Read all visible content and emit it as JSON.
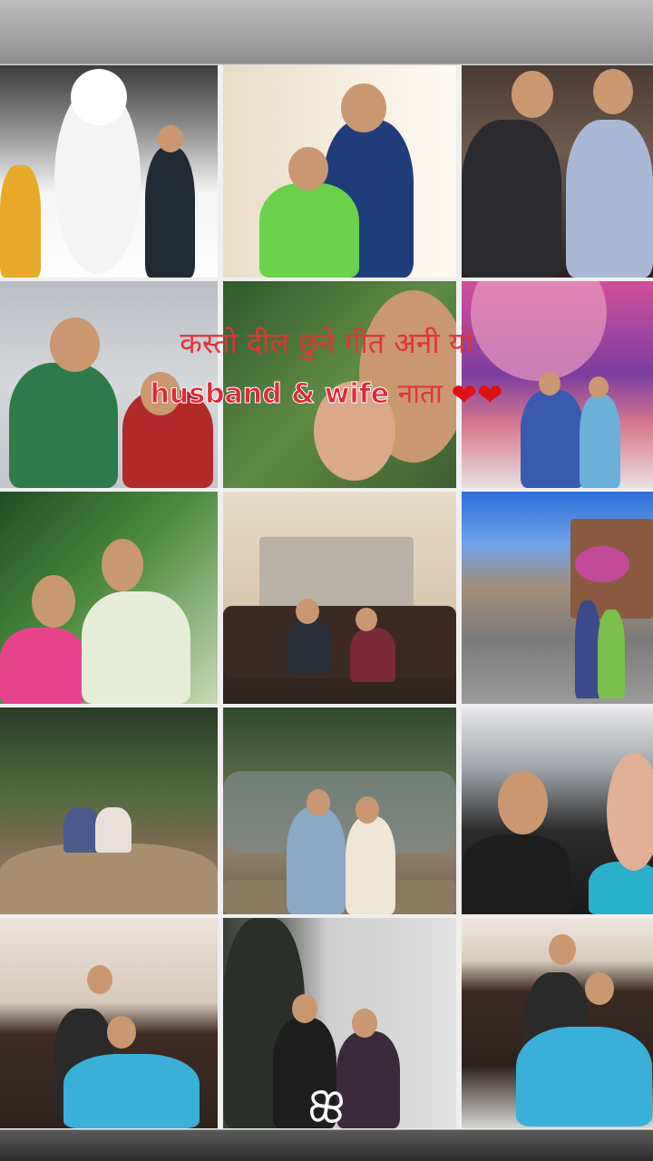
{
  "caption": {
    "line1": "कस्तो दील छुने गीत अनी यो",
    "line2_bold": "husband & wife",
    "line2_rest": "नाता",
    "hearts": "❤❤"
  },
  "icons": {
    "logo": "app-logo-icon",
    "heart": "heart-icon"
  },
  "colors": {
    "caption_red": "#e2343a",
    "background": "#efefef"
  }
}
